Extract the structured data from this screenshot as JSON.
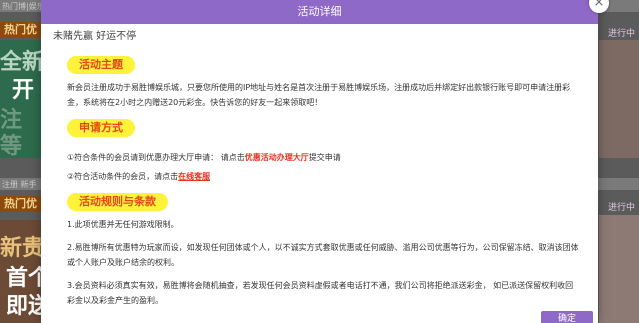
{
  "background": {
    "top_bar_text": "热门博|娱乐",
    "mid_bar_text": "注册 新手",
    "tab_1": "热门优",
    "tab_2": "热门优",
    "big_1": "全新",
    "big_2": "开",
    "big_3": "注",
    "big_4": "等",
    "big_5": "新贵",
    "big_6": "首个",
    "big_7": "即送",
    "right_label_1": "进行中",
    "right_label_2": "进行中"
  },
  "modal": {
    "title": "活动详细",
    "close_symbol": "×",
    "tagline": "未赌先赢 好运不停",
    "sections": {
      "theme": {
        "heading": "活动主题",
        "text": "新会员注册成功于易胜博娱乐城，只要您所使用的IP地址与姓名是首次注册于易胜博娱乐场，注册成功后并绑定好出款银行账号即可申请注册彩金，系统将在2小时之内赠送20元彩金。快告诉您的好友一起来领取吧！"
      },
      "apply": {
        "heading": "申请方式",
        "line1_prefix": "①符合条件的会员请到优惠办理大厅申请：  请点击",
        "line1_link": "优惠活动办理大厅",
        "line1_suffix": "提交申请",
        "line2_prefix": "②符合活动条件的会员，请点击",
        "line2_link": "在线客服"
      },
      "rules": {
        "heading": "活动规则与条款",
        "items": [
          "1.此项优惠并无任何游戏限制。",
          "2.易胜博所有优惠特为玩家而设，如发现任何团体或个人，以不诚实方式套取优惠或任何威胁、滥用公司优惠等行为，公司保留冻结、取消该团体或个人账户及账户结余的权利。",
          "3.会员资料必须真实有效，易胜博将会随机抽查，若发现任何会员资料虚假或者电话打不通，我们公司将拒绝派送彩金， 如已派送保留权利收回彩金以及彩金产生的盈利。"
        ]
      }
    },
    "confirm_label": "确定"
  }
}
